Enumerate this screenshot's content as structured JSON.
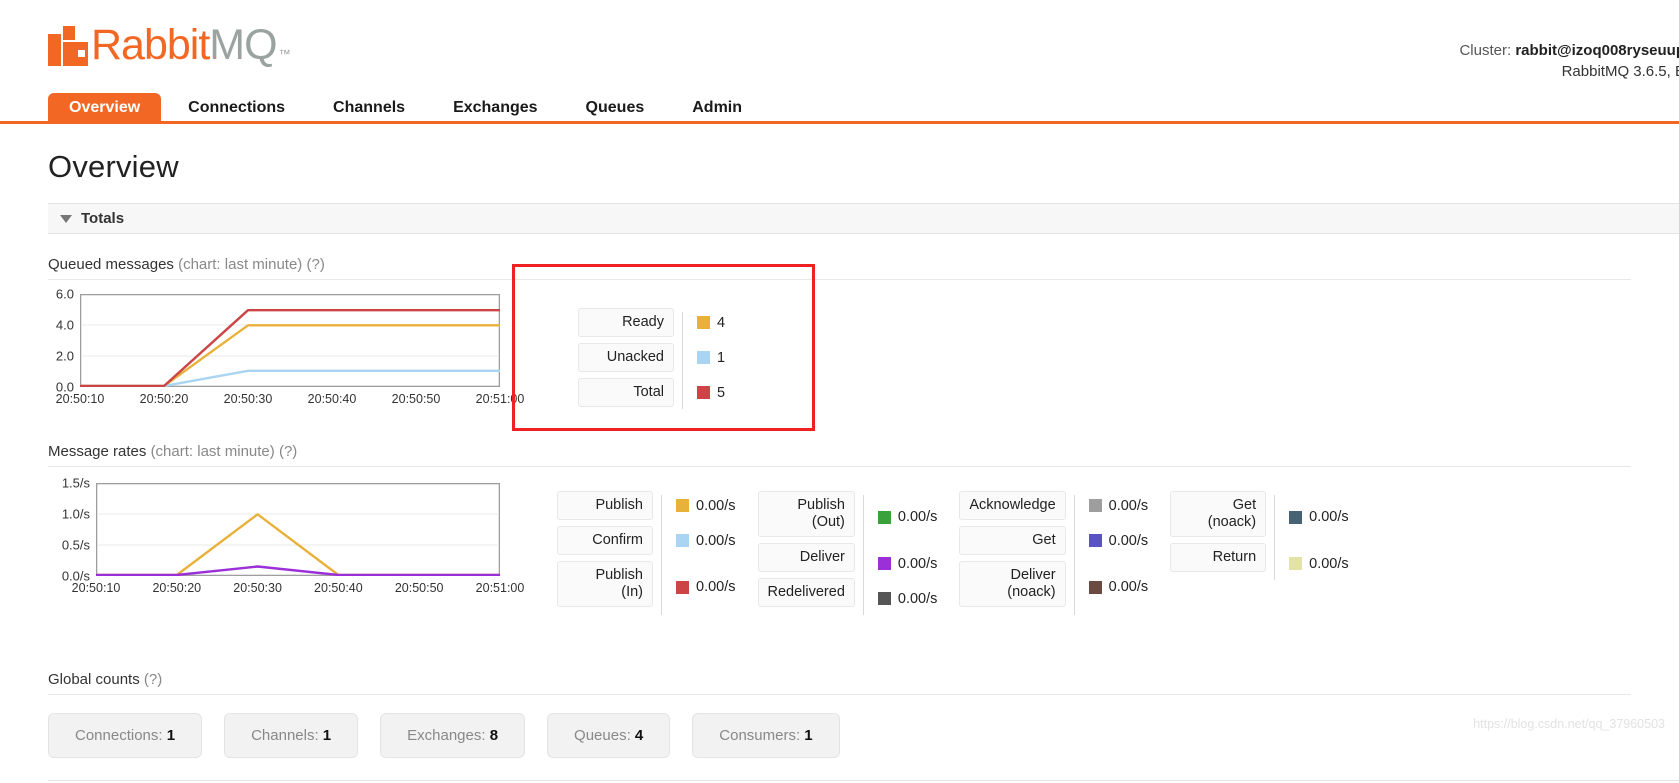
{
  "brand": {
    "name_primary": "Rabbit",
    "name_secondary": "MQ",
    "trademark": "™",
    "accent_color": "#f26724"
  },
  "header": {
    "cluster_label": "Cluster:",
    "cluster_name": "rabbit@izoq008ryseuup",
    "version_line": "RabbitMQ 3.6.5, E"
  },
  "nav": {
    "items": [
      {
        "label": "Overview",
        "active": true
      },
      {
        "label": "Connections",
        "active": false
      },
      {
        "label": "Channels",
        "active": false
      },
      {
        "label": "Exchanges",
        "active": false
      },
      {
        "label": "Queues",
        "active": false
      },
      {
        "label": "Admin",
        "active": false
      }
    ]
  },
  "page": {
    "title": "Overview",
    "totals_section": "Totals",
    "global_counts_label": "Global counts",
    "help_marker": "(?)"
  },
  "queued_messages": {
    "label": "Queued messages",
    "sublabel": "(chart: last minute)",
    "help": "(?)",
    "legend": [
      {
        "label": "Ready",
        "value": "4",
        "color": "#e8b13a"
      },
      {
        "label": "Unacked",
        "value": "1",
        "color": "#a9d5f2"
      },
      {
        "label": "Total",
        "value": "5",
        "color": "#cc4445"
      }
    ]
  },
  "message_rates": {
    "label": "Message rates",
    "sublabel": "(chart: last minute)",
    "help": "(?)",
    "columns": [
      {
        "entries": [
          {
            "label": "Publish",
            "value": "0.00/s",
            "color": "#e8b13a"
          },
          {
            "label": "Confirm",
            "value": "0.00/s",
            "color": "#a9d5f2"
          },
          {
            "label": "Publish\n(In)",
            "value": "0.00/s",
            "color": "#cc4445"
          }
        ]
      },
      {
        "entries": [
          {
            "label": "Publish\n(Out)",
            "value": "0.00/s",
            "color": "#3ba23b"
          },
          {
            "label": "Deliver",
            "value": "0.00/s",
            "color": "#9b30d9"
          },
          {
            "label": "Redelivered",
            "value": "0.00/s",
            "color": "#555555"
          }
        ]
      },
      {
        "entries": [
          {
            "label": "Acknowledge",
            "value": "0.00/s",
            "color": "#9e9e9e"
          },
          {
            "label": "Get",
            "value": "0.00/s",
            "color": "#5b52c4"
          },
          {
            "label": "Deliver\n(noack)",
            "value": "0.00/s",
            "color": "#6b4a42"
          }
        ]
      },
      {
        "entries": [
          {
            "label": "Get\n(noack)",
            "value": "0.00/s",
            "color": "#466273"
          },
          {
            "label": "Return",
            "value": "0.00/s",
            "color": "#e3e3a8"
          }
        ]
      }
    ]
  },
  "global_counts": [
    {
      "label": "Connections:",
      "value": "1"
    },
    {
      "label": "Channels:",
      "value": "1"
    },
    {
      "label": "Exchanges:",
      "value": "8"
    },
    {
      "label": "Queues:",
      "value": "4"
    },
    {
      "label": "Consumers:",
      "value": "1"
    }
  ],
  "watermark": "https://blog.csdn.net/qq_37960503",
  "chart_data": [
    {
      "type": "line",
      "title": "Queued messages",
      "subtitle": "chart: last minute",
      "xlabel": "",
      "ylabel": "",
      "x": [
        "20:50:10",
        "20:50:20",
        "20:50:30",
        "20:50:40",
        "20:50:50",
        "20:51:00"
      ],
      "xticks": [
        "20:50:10",
        "20:50:20",
        "20:50:30",
        "20:50:40",
        "20:50:50",
        "20:51:00"
      ],
      "yticks": [
        "0.0",
        "2.0",
        "4.0",
        "6.0"
      ],
      "ylim": [
        0,
        6
      ],
      "grid": true,
      "legend_position": "right",
      "series": [
        {
          "name": "Ready",
          "color": "#e8b13a",
          "values": [
            0,
            0,
            4,
            4,
            4,
            4
          ]
        },
        {
          "name": "Unacked",
          "color": "#a9d5f2",
          "values": [
            0,
            0,
            1,
            1,
            1,
            1
          ]
        },
        {
          "name": "Total",
          "color": "#cc4445",
          "values": [
            0,
            0,
            5,
            5,
            5,
            5
          ]
        }
      ]
    },
    {
      "type": "line",
      "title": "Message rates",
      "subtitle": "chart: last minute",
      "xlabel": "",
      "ylabel": "",
      "x": [
        "20:50:10",
        "20:50:20",
        "20:50:30",
        "20:50:40",
        "20:50:50",
        "20:51:00"
      ],
      "xticks": [
        "20:50:10",
        "20:50:20",
        "20:50:30",
        "20:50:40",
        "20:50:50",
        "20:51:00"
      ],
      "yticks": [
        "0.0/s",
        "0.5/s",
        "1.0/s",
        "1.5/s"
      ],
      "ylim": [
        0,
        1.5
      ],
      "grid": true,
      "legend_position": "right",
      "series": [
        {
          "name": "Publish",
          "color": "#e8b13a",
          "values": [
            0,
            0,
            1.0,
            0,
            0,
            0
          ]
        },
        {
          "name": "Deliver",
          "color": "#9b30d9",
          "values": [
            0,
            0,
            0.14,
            0,
            0,
            0
          ]
        }
      ]
    }
  ]
}
